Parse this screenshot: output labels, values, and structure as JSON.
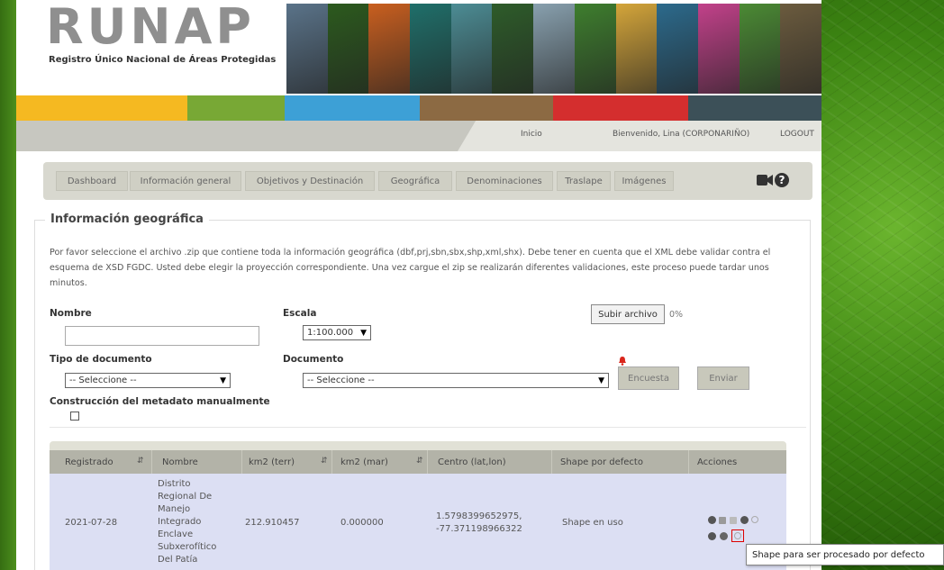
{
  "header": {
    "logo": "RUNAP",
    "logo_subtitle": "Registro Único Nacional de Áreas Protegidas",
    "strip_colors": [
      "#f5b921",
      "#78a835",
      "#3da0d6",
      "#8c6a43",
      "#d42e2e",
      "#3c5058"
    ],
    "photo_colors": [
      "#5a7389",
      "#2c5a1e",
      "#c95f1f",
      "#1f6f6a",
      "#4c8c94",
      "#2e5c2a",
      "#88a0ae",
      "#3e7e2e",
      "#d4a53a",
      "#2c6a8c",
      "#c2418a",
      "#4b8a34",
      "#6b5b3e"
    ]
  },
  "topnav": {
    "inicio": "Inicio",
    "welcome": "Bienvenido, Lina (CORPONARIÑO)",
    "logout": "LOGOUT"
  },
  "tabs": [
    "Dashboard",
    "Información general",
    "Objetivos y Destinación",
    "Geográfica",
    "Denominaciones",
    "Traslape",
    "Imágenes"
  ],
  "section": {
    "title": "Información geográfica",
    "intro": "Por favor seleccione el archivo .zip que contiene toda la información geográfica (dbf,prj,sbn,sbx,shp,xml,shx). Debe tener en cuenta que el XML debe validar contra el esquema de XSD FGDC. Usted debe elegir la proyección correspondiente. Una vez cargue el zip se realizarán diferentes validaciones, este proceso puede tardar unos minutos."
  },
  "form": {
    "nombre_label": "Nombre",
    "nombre_value": "",
    "escala_label": "Escala",
    "escala_value": "1:100.000",
    "subir_label": "Subir archivo",
    "upload_progress": "0%",
    "tipo_label": "Tipo de documento",
    "tipo_value": "-- Seleccione --",
    "documento_label": "Documento",
    "documento_value": "-- Seleccione --",
    "encuesta_label": "Encuesta",
    "enviar_label": "Enviar",
    "metadato_label": "Construcción del metadato manualmente"
  },
  "table": {
    "headers": [
      "Registrado",
      "Nombre",
      "km2 (terr)",
      "km2 (mar)",
      "Centro (lat,lon)",
      "Shape por defecto",
      "Acciones"
    ],
    "row": {
      "registrado": "2021-07-28",
      "nombre": "Distrito Regional De Manejo Integrado Enclave Subxerofítico Del Patía",
      "km2_terr": "212.910457",
      "km2_mar": "0.000000",
      "centro_lat": "1.5798399652975,",
      "centro_lon": "-77.371198966322",
      "shape": "Shape en uso"
    }
  },
  "tooltip": "Shape para ser procesado por defecto"
}
